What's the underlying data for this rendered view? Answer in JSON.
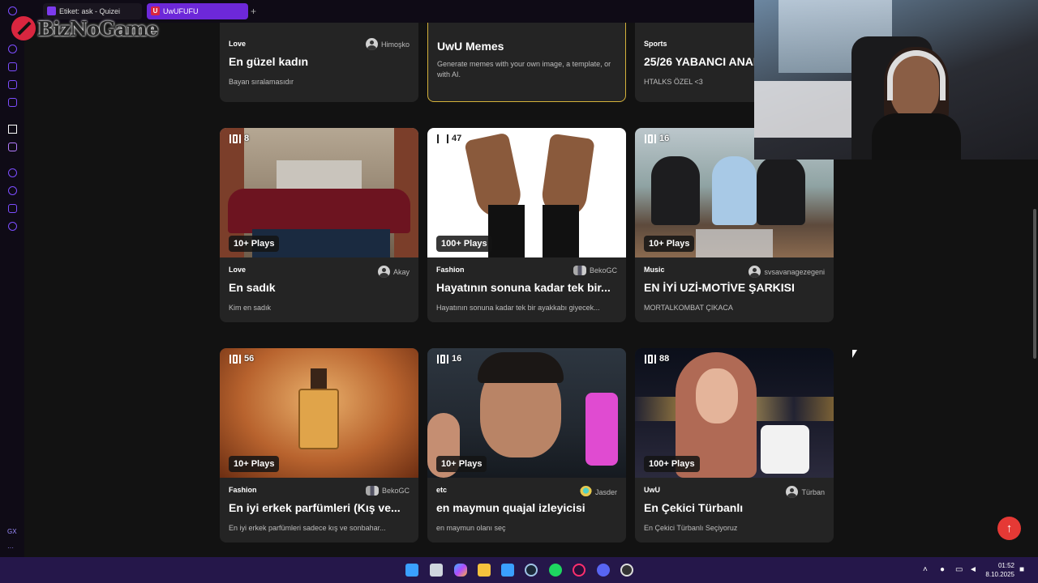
{
  "browser": {
    "tabs": [
      {
        "label": "Etiket: ask - Quizei",
        "active": false
      },
      {
        "label": "UwUFUFU",
        "active": true
      }
    ],
    "new_tab_label": "+",
    "watermark": "BizNoGame"
  },
  "sidebar": {
    "items": [
      "o-icon",
      "refresh-icon",
      "bag-icon",
      "tv-icon",
      "m-icon",
      "nav-icon",
      "twitch-icon",
      "play-icon",
      "clock-icon",
      "cube-icon",
      "settings-icon"
    ],
    "gx_label": "GX",
    "more_label": "···"
  },
  "top_cards": [
    {
      "category": "Love",
      "author": "Himoşko",
      "title": "En güzel kadın",
      "description": "Bayan sıralamasıdır"
    },
    {
      "category": "",
      "author": "",
      "title": "UwU Memes",
      "description": "Generate memes with your own image, a template, or with AI.",
      "featured": true
    },
    {
      "category": "Sports",
      "author": "",
      "title": "25/26 YABANCI ANAD",
      "description": "HTALKS ÖZEL <3"
    }
  ],
  "cards": [
    {
      "count": "8",
      "plays": "10+ Plays",
      "category": "Love",
      "author": "Akay",
      "title": "En sadık",
      "description": "Kim en sadık",
      "art": "love"
    },
    {
      "count": "47",
      "plays": "100+ Plays",
      "category": "Fashion",
      "author": "BekoGC",
      "title": "Hayatının sonuna kadar tek bir...",
      "description": "Hayatının sonuna kadar tek bir ayakkabı giyecek...",
      "art": "sandals"
    },
    {
      "count": "16",
      "plays": "10+ Plays",
      "category": "Music",
      "author": "svsavanagezegeni",
      "title": "EN İYİ UZİ-MOTİVE ŞARKISI",
      "description": "MORTALKOMBAT ÇIKACA",
      "art": "music"
    },
    {
      "count": "56",
      "plays": "10+ Plays",
      "category": "Fashion",
      "author": "BekoGC",
      "title": "En iyi erkek parfümleri (Kış ve...",
      "description": "En iyi erkek parfümleri sadece kış ve sonbahar...",
      "art": "perfume"
    },
    {
      "count": "16",
      "plays": "10+ Plays",
      "category": "etc",
      "author": "Jasder",
      "title": "en maymun quajal izleyicisi",
      "description": "en maymun olanı seç",
      "art": "streamer"
    },
    {
      "count": "88",
      "plays": "100+ Plays",
      "category": "UwU",
      "author": "Türban",
      "title": "En Çekici Türbanlı",
      "description": "En Çekici Türbanlı Seçiyoruz",
      "art": "night"
    }
  ],
  "fab_icon": "↑",
  "taskbar": {
    "icons": [
      "windows-icon",
      "task-view-icon",
      "copilot-icon",
      "explorer-icon",
      "store-icon",
      "steam-icon",
      "spotify-icon",
      "opera-gx-icon",
      "discord-icon",
      "settings-icon"
    ],
    "time": "01:52",
    "date": "8.10.2025"
  },
  "colors": {
    "accent_purple": "#6d28d9",
    "featured_border": "#d4b13a",
    "fab_red": "#e53935",
    "taskbar": "#25174a"
  }
}
